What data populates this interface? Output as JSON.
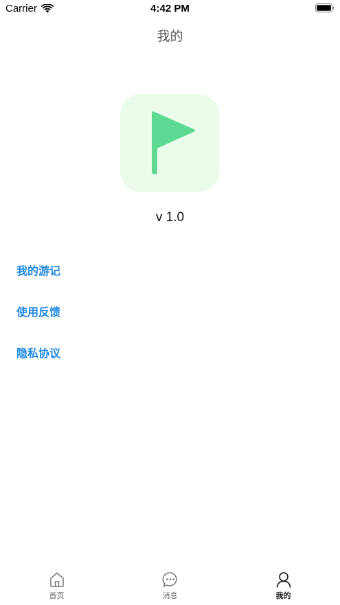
{
  "status_bar": {
    "carrier": "Carrier",
    "time": "4:42 PM"
  },
  "nav": {
    "title": "我的"
  },
  "app": {
    "icon": "flag-icon",
    "version": "v 1.0",
    "icon_bg_color": "#eafbea",
    "flag_color": "#5dd994"
  },
  "menu": {
    "items": [
      {
        "label": "我的游记"
      },
      {
        "label": "使用反馈"
      },
      {
        "label": "隐私协议"
      }
    ],
    "color": "#1e88e5"
  },
  "tab_bar": {
    "tabs": [
      {
        "label": "首页",
        "icon": "home-icon",
        "active": false
      },
      {
        "label": "消息",
        "icon": "chat-bubble-icon",
        "active": false
      },
      {
        "label": "我的",
        "icon": "person-icon",
        "active": true
      }
    ]
  }
}
